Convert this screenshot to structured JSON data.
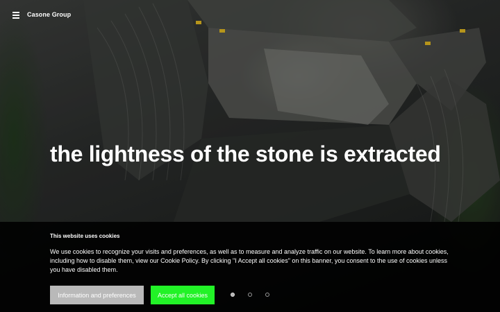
{
  "header": {
    "brand": "Casone Group",
    "menu_icon": "hamburger-menu-icon"
  },
  "hero": {
    "headline": "the lightness of the stone is extracted",
    "image": "aerial-quarry-photo",
    "slides": {
      "count": 3,
      "active_index": 0
    }
  },
  "cookie_banner": {
    "title": "This website uses cookies",
    "text": "We use cookies to recognize your visits and preferences, as well as to measure and analyze traffic on our website. To learn more about cookies, including how to disable them, view our Cookie Policy. By clicking \"I Accept all cookies\" on this banner, you consent to the use of cookies unless you have disabled them.",
    "info_button": "Information and preferences",
    "accept_button": "Accept all cookies"
  },
  "colors": {
    "accept_button_bg": "#22f227",
    "info_button_bg": "#b9b9b9",
    "banner_bg": "#000000",
    "text": "#ffffff"
  }
}
